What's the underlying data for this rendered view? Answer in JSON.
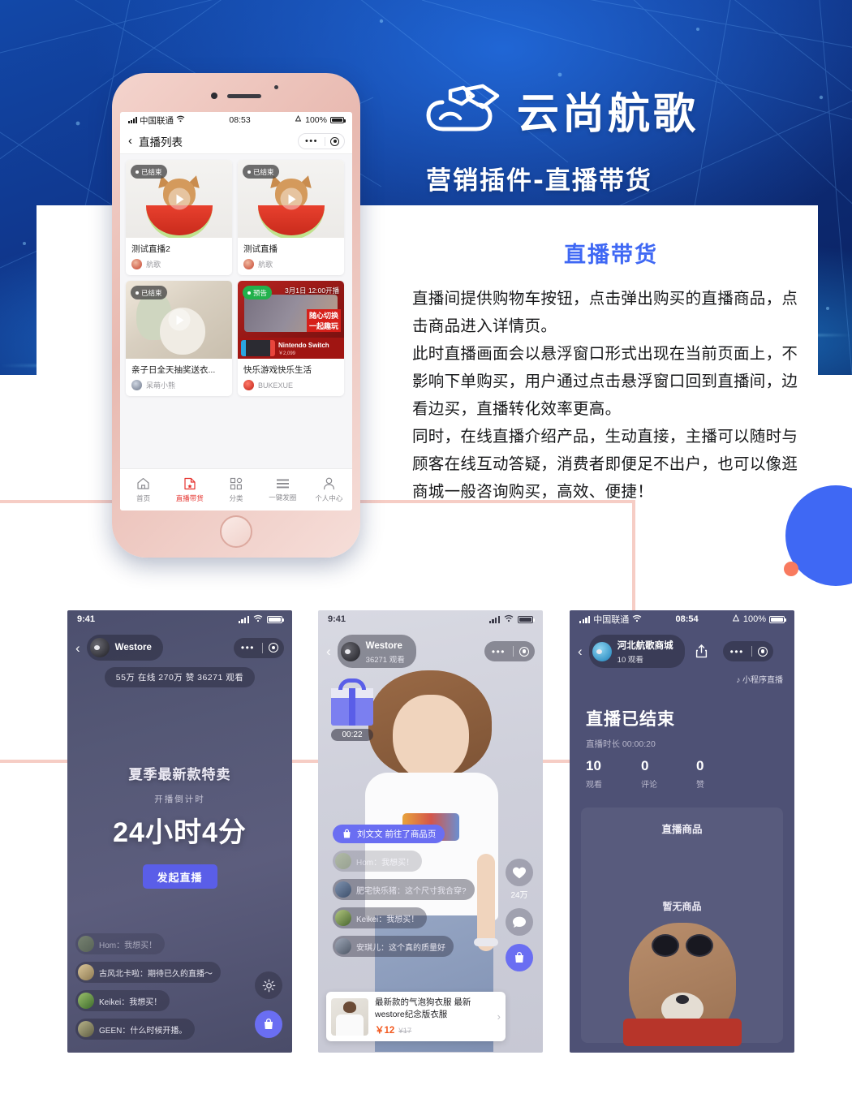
{
  "brand": {
    "logo_icon": "cloud-logo-icon",
    "name": "云尚航歌",
    "subtitle": "营销插件-直播带货"
  },
  "description": {
    "title": "直播带货",
    "paragraphs": [
      "直播间提供购物车按钮，点击弹出购买的直播商品，点击商品进入详情页。",
      "此时直播画面会以悬浮窗口形式出现在当前页面上，不影响下单购买，用户通过点击悬浮窗口回到直播间，边看边买，直播转化效率更高。",
      "同时，在线直播介绍产品，生动直接，主播可以随时与顾客在线互动答疑，消费者即便足不出户，也可以像逛商城一般咨询购买，高效、便捷！"
    ]
  },
  "phone_main": {
    "status": {
      "carrier": "中国联通",
      "time": "08:53",
      "battery": "100%"
    },
    "nav": {
      "back_icon": "chevron-left-icon",
      "title": "直播列表",
      "more_icon": "more-dots-icon",
      "target_icon": "capsule-target-icon"
    },
    "cards": [
      {
        "badge": "已结束",
        "badge_type": "ended",
        "time_note": "",
        "title": "测试直播2",
        "user": "航歌",
        "thumb": "dog-watermelon"
      },
      {
        "badge": "已结束",
        "badge_type": "ended",
        "time_note": "",
        "title": "测试直播",
        "user": "航歌",
        "thumb": "dog-watermelon"
      },
      {
        "badge": "已结束",
        "badge_type": "ended",
        "time_note": "",
        "title": "亲子日全天抽奖送衣...",
        "user": "呆萌小熊",
        "thumb": "wedding"
      },
      {
        "badge": "预告",
        "badge_type": "upcoming",
        "time_note": "3月1日 12:00开播",
        "title": "快乐游戏快乐生活",
        "user": "BUKEXUE",
        "thumb": "game-switch"
      }
    ],
    "tabs": [
      {
        "label": "首页",
        "icon": "home-icon",
        "active": false
      },
      {
        "label": "直播带货",
        "icon": "live-commerce-icon",
        "active": true
      },
      {
        "label": "分类",
        "icon": "grid-category-icon",
        "active": false
      },
      {
        "label": "一键发圈",
        "icon": "menu-lines-icon",
        "active": false
      },
      {
        "label": "个人中心",
        "icon": "person-icon",
        "active": false
      }
    ]
  },
  "shot_countdown": {
    "status": {
      "time": "9:41"
    },
    "room_name": "Westore",
    "stats_pill": "55万 在线  270万 赞  36271 观看",
    "sale_title": "夏季最新款特卖",
    "countdown_label": "开播倒计时",
    "countdown_value": "24小时4分",
    "start_button": "发起直播",
    "chats": [
      {
        "user": "Hom",
        "text": "我想买！"
      },
      {
        "user": "古风北卡啦",
        "text": "期待已久的直播～"
      },
      {
        "user": "Keikei",
        "text": "我想买！"
      },
      {
        "user": "GEEN",
        "text": "什么时候开播。"
      }
    ],
    "side_buttons": [
      {
        "icon": "gear-icon",
        "label": ""
      },
      {
        "icon": "shopping-bag-icon",
        "label": ""
      }
    ]
  },
  "shot_live": {
    "status": {
      "time": "9:41"
    },
    "room_name": "Westore",
    "room_sub": "36271 观看",
    "gift_timer": "00:22",
    "enter_notice": "刘文文 前往了商品页",
    "chats": [
      {
        "user": "Hom",
        "text": "我想买！"
      },
      {
        "user": "肥宅快乐猪",
        "text": "这个尺寸我合穿?"
      },
      {
        "user": "Keikei",
        "text": "我想买！"
      },
      {
        "user": "安琪儿",
        "text": "这个真的质量好"
      }
    ],
    "like_count": "24万",
    "product": {
      "name": "最新款的气泡狗衣服 最新westore纪念版衣服",
      "price": "￥12",
      "original_price": "¥17"
    }
  },
  "shot_ended": {
    "status": {
      "carrier": "中国联通",
      "time": "08:54",
      "battery": "100%"
    },
    "room_name": "河北航歌商城",
    "room_sub": "10 观看",
    "mini_live_label": "小程序直播",
    "ended_title": "直播已结束",
    "duration": "直播时长 00:00:20",
    "stats": [
      {
        "value": "10",
        "label": "观看"
      },
      {
        "value": "0",
        "label": "评论"
      },
      {
        "value": "0",
        "label": "赞"
      }
    ],
    "goods_title": "直播商品",
    "goods_empty": "暂无商品"
  },
  "colors": {
    "brand_blue": "#3f68f4",
    "hero_blue": "#10388f",
    "accent_pink": "#f6cdc5",
    "accent_coral": "#f87a5f",
    "tab_active_red": "#e5322d",
    "price_orange": "#f2591f",
    "purple_btn": "#6a6ef2"
  }
}
